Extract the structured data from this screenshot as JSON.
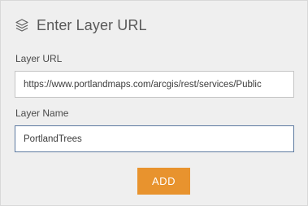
{
  "header": {
    "icon": "layers-icon",
    "title": "Enter Layer URL"
  },
  "fields": {
    "layer_url": {
      "label": "Layer URL",
      "value": "https://www.portlandmaps.com/arcgis/rest/services/Public"
    },
    "layer_name": {
      "label": "Layer Name",
      "value": "PortlandTrees"
    }
  },
  "actions": {
    "add_label": "ADD"
  },
  "colors": {
    "panel_background": "#efefef",
    "button_accent": "#e8932e",
    "focused_border": "#5d7aa0"
  }
}
